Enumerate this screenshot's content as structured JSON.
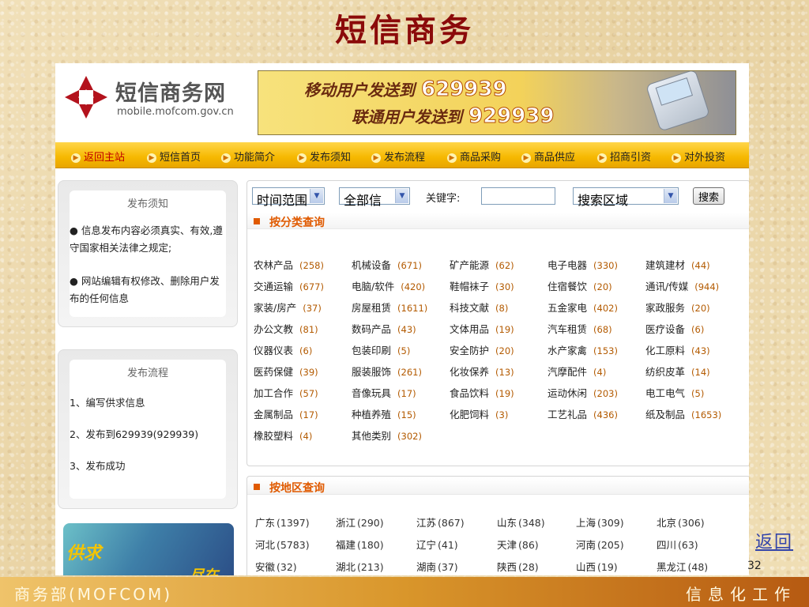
{
  "slide": {
    "title": "短信商务",
    "return_link": "返回",
    "page_number": "32",
    "footer_left": "商务部(MOFCOM)",
    "footer_right": "信息化工作"
  },
  "site": {
    "logo_name": "短信商务网",
    "logo_url": "mobile.mofcom.gov.cn",
    "banner_line1": "移动用户发送到",
    "banner_num1": "629939",
    "banner_line2": "联通用户发送到",
    "banner_num2": "929939"
  },
  "nav": [
    "返回主站",
    "短信首页",
    "功能简介",
    "发布须知",
    "发布流程",
    "商品采购",
    "商品供应",
    "招商引资",
    "对外投资"
  ],
  "sidebar": {
    "notice": {
      "title": "发布须知",
      "items": [
        "● 信息发布内容必须真实、有效,遵守国家相关法律之规定;",
        "● 网站编辑有权修改、删除用户发布的任何信息"
      ]
    },
    "process": {
      "title": "发布流程",
      "items": [
        "1、编写供求信息",
        "2、发布到629939(929939)",
        "3、发布成功"
      ]
    },
    "promo_text1": "供求",
    "promo_text2": "尽在"
  },
  "search": {
    "time_range": "时间范围",
    "all_info": "全部信息",
    "keyword_label": "关键字:",
    "keyword_value": "",
    "region_select": "搜索区域",
    "search_button": "搜索"
  },
  "categories_title": "按分类查询",
  "categories": [
    {
      "name": "农林产品",
      "count": "(258)"
    },
    {
      "name": "机械设备",
      "count": "(671)"
    },
    {
      "name": "矿产能源",
      "count": "(62)"
    },
    {
      "name": "电子电器",
      "count": "(330)"
    },
    {
      "name": "建筑建材",
      "count": "(44)"
    },
    {
      "name": "交通运输",
      "count": "(677)"
    },
    {
      "name": "电脑/软件",
      "count": "(420)"
    },
    {
      "name": "鞋帽袜子",
      "count": "(30)"
    },
    {
      "name": "住宿餐饮",
      "count": "(20)"
    },
    {
      "name": "通讯/传媒",
      "count": "(944)"
    },
    {
      "name": "家装/房产",
      "count": "(37)"
    },
    {
      "name": "房屋租赁",
      "count": "(1611)"
    },
    {
      "name": "科技文献",
      "count": "(8)"
    },
    {
      "name": "五金家电",
      "count": "(402)"
    },
    {
      "name": "家政服务",
      "count": "(20)"
    },
    {
      "name": "办公文教",
      "count": "(81)"
    },
    {
      "name": "数码产品",
      "count": "(43)"
    },
    {
      "name": "文体用品",
      "count": "(19)"
    },
    {
      "name": "汽车租赁",
      "count": "(68)"
    },
    {
      "name": "医疗设备",
      "count": "(6)"
    },
    {
      "name": "仪器仪表",
      "count": "(6)"
    },
    {
      "name": "包装印刷",
      "count": "(5)"
    },
    {
      "name": "安全防护",
      "count": "(20)"
    },
    {
      "name": "水产家禽",
      "count": "(153)"
    },
    {
      "name": "化工原料",
      "count": "(43)"
    },
    {
      "name": "医药保健",
      "count": "(39)"
    },
    {
      "name": "服装服饰",
      "count": "(261)"
    },
    {
      "name": "化妆保养",
      "count": "(13)"
    },
    {
      "name": "汽摩配件",
      "count": "(4)"
    },
    {
      "name": "纺织皮革",
      "count": "(14)"
    },
    {
      "name": "加工合作",
      "count": "(57)"
    },
    {
      "name": "音像玩具",
      "count": "(17)"
    },
    {
      "name": "食品饮料",
      "count": "(19)"
    },
    {
      "name": "运动休闲",
      "count": "(203)"
    },
    {
      "name": "电工电气",
      "count": "(5)"
    },
    {
      "name": "金属制品",
      "count": "(17)"
    },
    {
      "name": "种植养殖",
      "count": "(15)"
    },
    {
      "name": "化肥饲料",
      "count": "(3)"
    },
    {
      "name": "工艺礼品",
      "count": "(436)"
    },
    {
      "name": "纸及制品",
      "count": "(1653)"
    },
    {
      "name": "橡胶塑料",
      "count": "(4)"
    },
    {
      "name": "其他类别",
      "count": "(302)"
    }
  ],
  "regions_title": "按地区查询",
  "regions": [
    {
      "name": "广东",
      "count": "(1397)"
    },
    {
      "name": "浙江",
      "count": "(290)"
    },
    {
      "name": "江苏",
      "count": "(867)"
    },
    {
      "name": "山东",
      "count": "(348)"
    },
    {
      "name": "上海",
      "count": "(309)"
    },
    {
      "name": "北京",
      "count": "(306)"
    },
    {
      "name": "河北",
      "count": "(5783)"
    },
    {
      "name": "福建",
      "count": "(180)"
    },
    {
      "name": "辽宁",
      "count": "(41)"
    },
    {
      "name": "天津",
      "count": "(86)"
    },
    {
      "name": "河南",
      "count": "(205)"
    },
    {
      "name": "四川",
      "count": "(63)"
    },
    {
      "name": "安徽",
      "count": "(32)"
    },
    {
      "name": "湖北",
      "count": "(213)"
    },
    {
      "name": "湖南",
      "count": "(37)"
    },
    {
      "name": "陕西",
      "count": "(28)"
    },
    {
      "name": "山西",
      "count": "(19)"
    },
    {
      "name": "黑龙江",
      "count": "(48)"
    }
  ],
  "colors": {
    "title": "#8b0a0a",
    "nav": "#f6b800",
    "count": "#b35a00",
    "section": "#e05a00"
  }
}
